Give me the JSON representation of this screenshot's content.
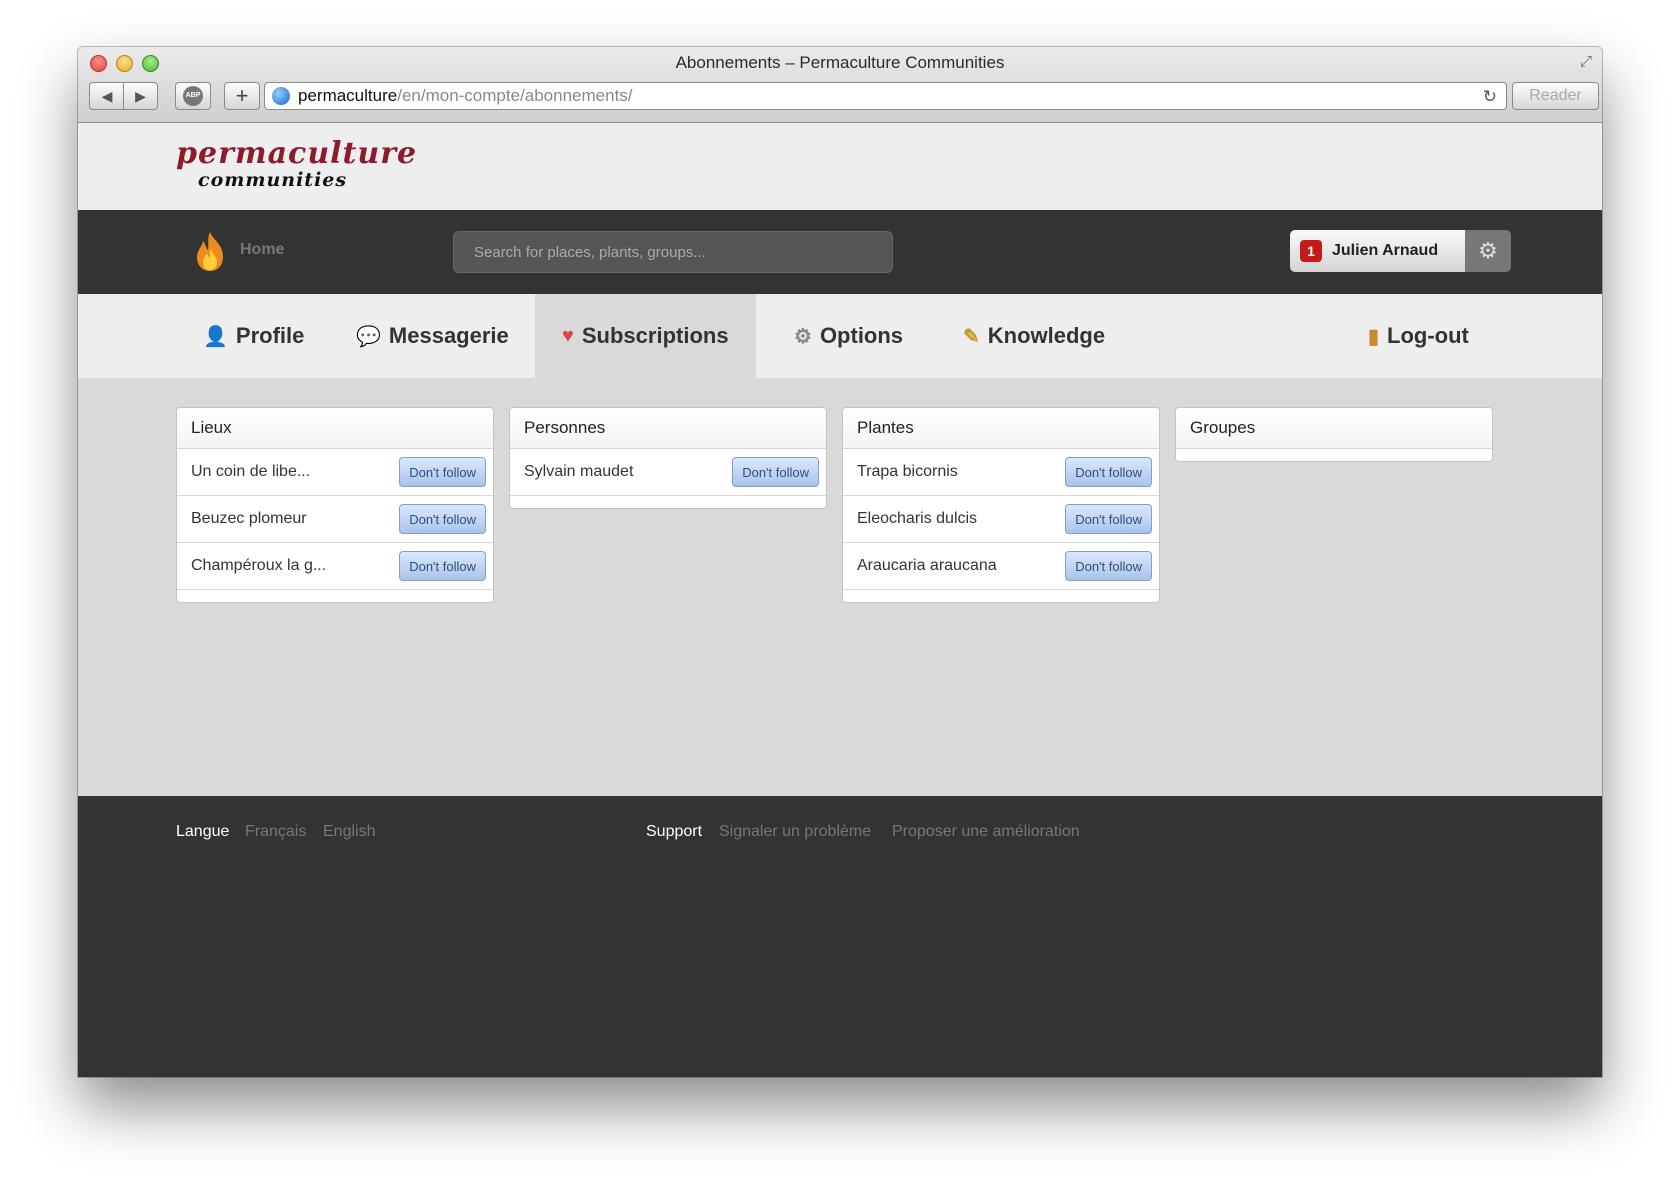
{
  "browser": {
    "window_title": "Abonnements – Permaculture Communities",
    "url_host": "permaculture",
    "url_path": "/en/mon-compte/abonnements/",
    "abp_label": "ABP",
    "reader_label": "Reader"
  },
  "site": {
    "logo_line1": "permaculture",
    "logo_line2": "communities"
  },
  "nav": {
    "home_label": "Home",
    "search_placeholder": "Search for places, plants, groups...",
    "notification_count": "1",
    "user_name": "Julien Arnaud"
  },
  "tabs": [
    {
      "label": "Profile",
      "icon": "person-icon"
    },
    {
      "label": "Messagerie",
      "icon": "speech-bubble-icon"
    },
    {
      "label": "Subscriptions",
      "icon": "heart-icon",
      "active": true
    },
    {
      "label": "Options",
      "icon": "gear-icon"
    },
    {
      "label": "Knowledge",
      "icon": "wand-icon"
    },
    {
      "label": "Log-out",
      "icon": "door-icon"
    }
  ],
  "panels": [
    {
      "title": "Lieux",
      "items": [
        {
          "name": "Un coin de libe...",
          "button": "Don't follow"
        },
        {
          "name": "Beuzec plomeur",
          "button": "Don't follow"
        },
        {
          "name": "Champéroux la g...",
          "button": "Don't follow"
        }
      ]
    },
    {
      "title": "Personnes",
      "items": [
        {
          "name": "Sylvain maudet",
          "button": "Don't follow"
        }
      ]
    },
    {
      "title": "Plantes",
      "items": [
        {
          "name": "Trapa bicornis",
          "button": "Don't follow"
        },
        {
          "name": "Eleocharis dulcis",
          "button": "Don't follow"
        },
        {
          "name": "Araucaria araucana",
          "button": "Don't follow"
        }
      ]
    },
    {
      "title": "Groupes",
      "items": []
    }
  ],
  "footer": {
    "langue_label": "Langue",
    "lang_fr": "Français",
    "lang_en": "English",
    "support_label": "Support",
    "report_problem": "Signaler un problème",
    "suggest_improvement": "Proposer une amélioration"
  },
  "colors": {
    "brand": "#8c1b2b",
    "dark_bar": "#333333",
    "badge": "#c61a1a"
  }
}
